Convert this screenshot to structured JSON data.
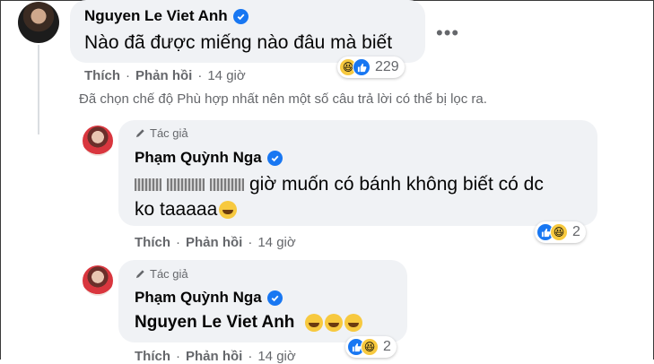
{
  "comment1": {
    "author": "Nguyen Le Viet Anh",
    "text": "Nào đã được miếng nào đâu mà biết",
    "like_action": "Thích",
    "reply_action": "Phản hồi",
    "time": "14 giờ",
    "reaction_count": "229",
    "reaction_icons": [
      "haha-icon",
      "like-icon"
    ]
  },
  "filter_note": "Đã chọn chế độ Phù hợp nhất nên một số câu trả lời có thể bị lọc ra.",
  "reply1": {
    "author_tag": "Tác giả",
    "author": "Phạm Quỳnh Nga",
    "text_line1": "giờ muốn có bánh không biết có dc",
    "text_line2": "ko taaaaa",
    "like_action": "Thích",
    "reply_action": "Phản hồi",
    "time": "14 giờ",
    "reaction_count": "2"
  },
  "reply2": {
    "author_tag": "Tác giả",
    "author": "Phạm Quỳnh Nga",
    "text": "Nguyen Le Viet Anh",
    "like_action": "Thích",
    "reply_action": "Phản hồi",
    "time": "14 giờ",
    "reaction_count": "2"
  },
  "colors": {
    "bubble": "#f0f2f5",
    "verified": "#1877f2",
    "meta_text": "#65676b"
  }
}
